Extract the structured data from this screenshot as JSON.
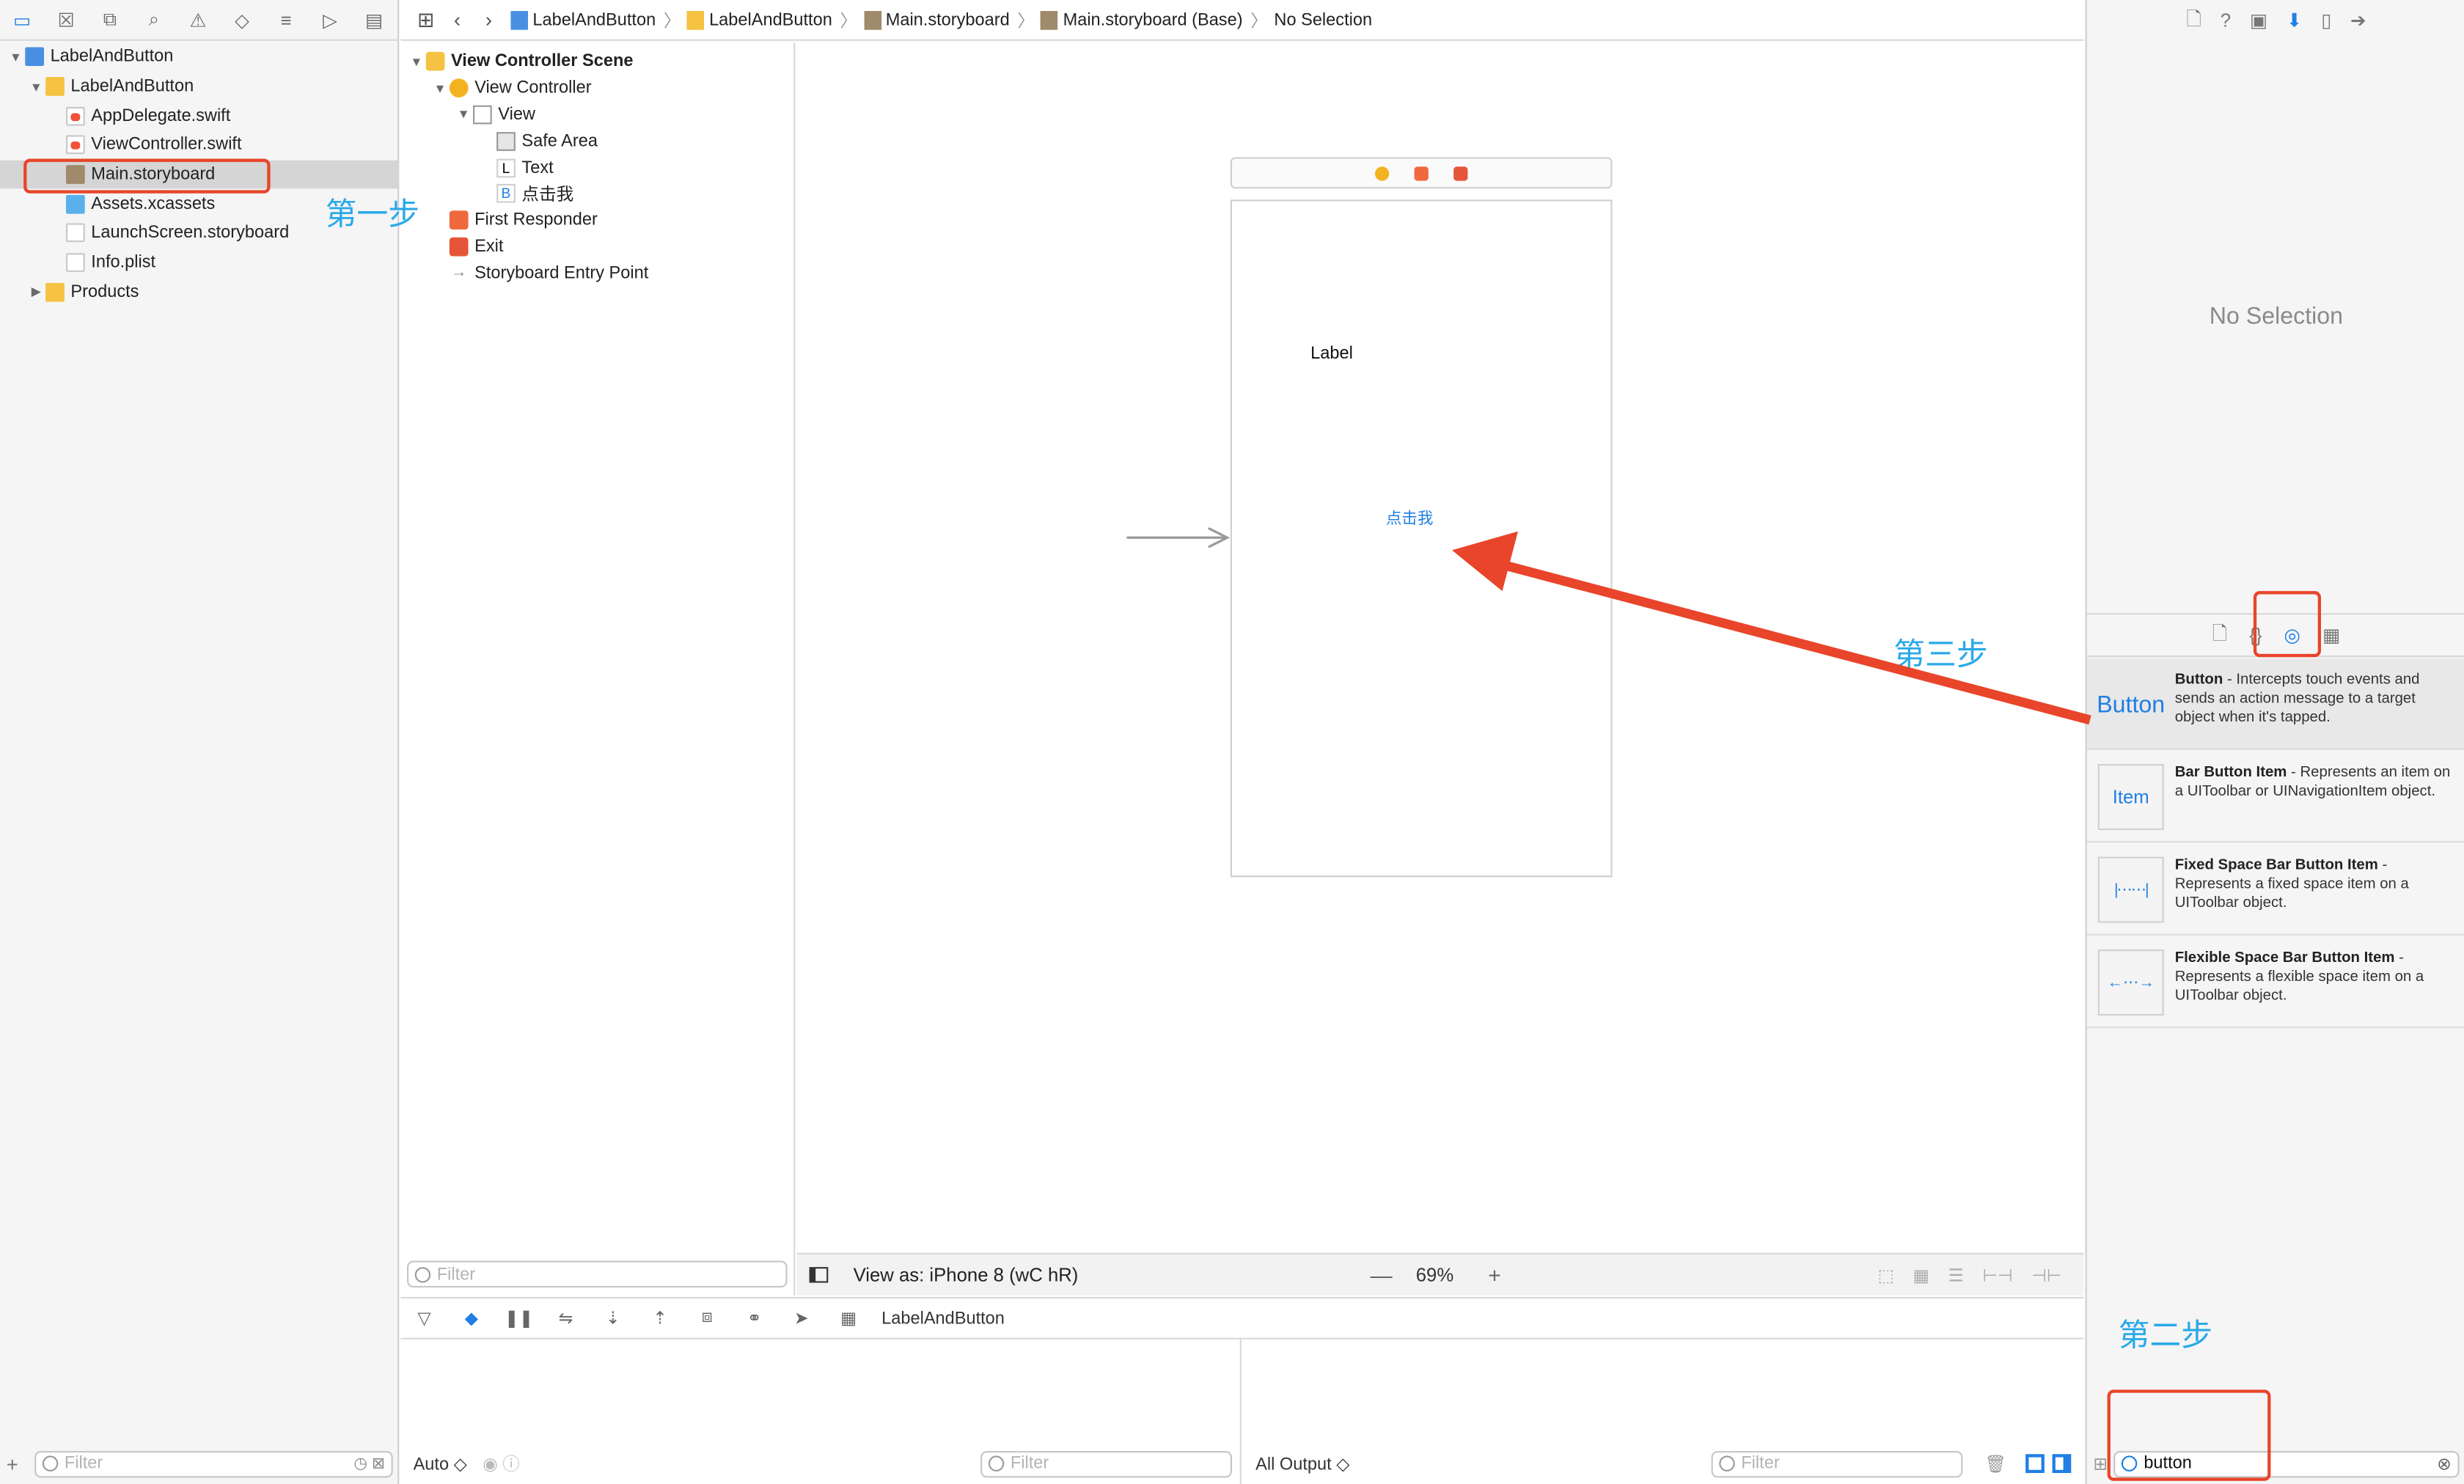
{
  "navigator": {
    "tree": [
      {
        "label": "LabelAndButton",
        "level": 0,
        "icon": "project-icon",
        "disclosure": "open"
      },
      {
        "label": "LabelAndButton",
        "level": 1,
        "icon": "folder-icon",
        "disclosure": "open"
      },
      {
        "label": "AppDelegate.swift",
        "level": 2,
        "icon": "swift-file-icon"
      },
      {
        "label": "ViewController.swift",
        "level": 2,
        "icon": "swift-file-icon"
      },
      {
        "label": "Main.storyboard",
        "level": 2,
        "icon": "storyboard-icon",
        "selected": true
      },
      {
        "label": "Assets.xcassets",
        "level": 2,
        "icon": "assets-icon"
      },
      {
        "label": "LaunchScreen.storyboard",
        "level": 2,
        "icon": "storyboard-icon"
      },
      {
        "label": "Info.plist",
        "level": 2,
        "icon": "plist-icon"
      },
      {
        "label": "Products",
        "level": 1,
        "icon": "folder-icon",
        "disclosure": "closed"
      }
    ],
    "filter_placeholder": "Filter"
  },
  "jumpbar": {
    "crumbs": [
      "LabelAndButton",
      "LabelAndButton",
      "Main.storyboard",
      "Main.storyboard (Base)",
      "No Selection"
    ]
  },
  "outline": {
    "rows": [
      {
        "label": "View Controller Scene",
        "icon": "scene",
        "bold": true
      },
      {
        "label": "View Controller",
        "icon": "vc"
      },
      {
        "label": "View",
        "icon": "view"
      },
      {
        "label": "Safe Area",
        "icon": "safe"
      },
      {
        "label": "Text",
        "icon": "lbl",
        "glyph": "L"
      },
      {
        "label": "点击我",
        "icon": "btn",
        "glyph": "B"
      },
      {
        "label": "First Responder",
        "icon": "fr"
      },
      {
        "label": "Exit",
        "icon": "exit"
      },
      {
        "label": "Storyboard Entry Point",
        "icon": "entry"
      }
    ],
    "filter_placeholder": "Filter"
  },
  "canvas": {
    "label_text": "Label",
    "button_text": "点击我",
    "view_as": "View as: iPhone 8 (wC hR)",
    "zoom": "69%"
  },
  "debug": {
    "scheme": "LabelAndButton",
    "auto_label": "Auto ◇",
    "all_output_label": "All Output ◇",
    "filter_placeholder": "Filter"
  },
  "inspector": {
    "no_selection": "No Selection"
  },
  "library": {
    "items": [
      {
        "thumb": "Button",
        "title": "Button",
        "desc": " - Intercepts touch events and sends an action message to a target object when it's tapped.",
        "selected": true
      },
      {
        "thumb": "Item",
        "title": "Bar Button Item",
        "desc": " - Represents an item on a UIToolbar or UINavigationItem object."
      },
      {
        "thumb": "fixed-space",
        "title": "Fixed Space Bar Button Item",
        "desc": " - Represents a fixed space item on a UIToolbar object."
      },
      {
        "thumb": "flexible-space",
        "title": "Flexible Space Bar Button Item",
        "desc": " - Represents a flexible space item on a UIToolbar object."
      }
    ],
    "search_value": "button"
  },
  "annotations": {
    "step1": "第一步",
    "step2": "第二步",
    "step3": "第三步",
    "color": "#e8452a",
    "text_color": "#2aa9e8"
  }
}
